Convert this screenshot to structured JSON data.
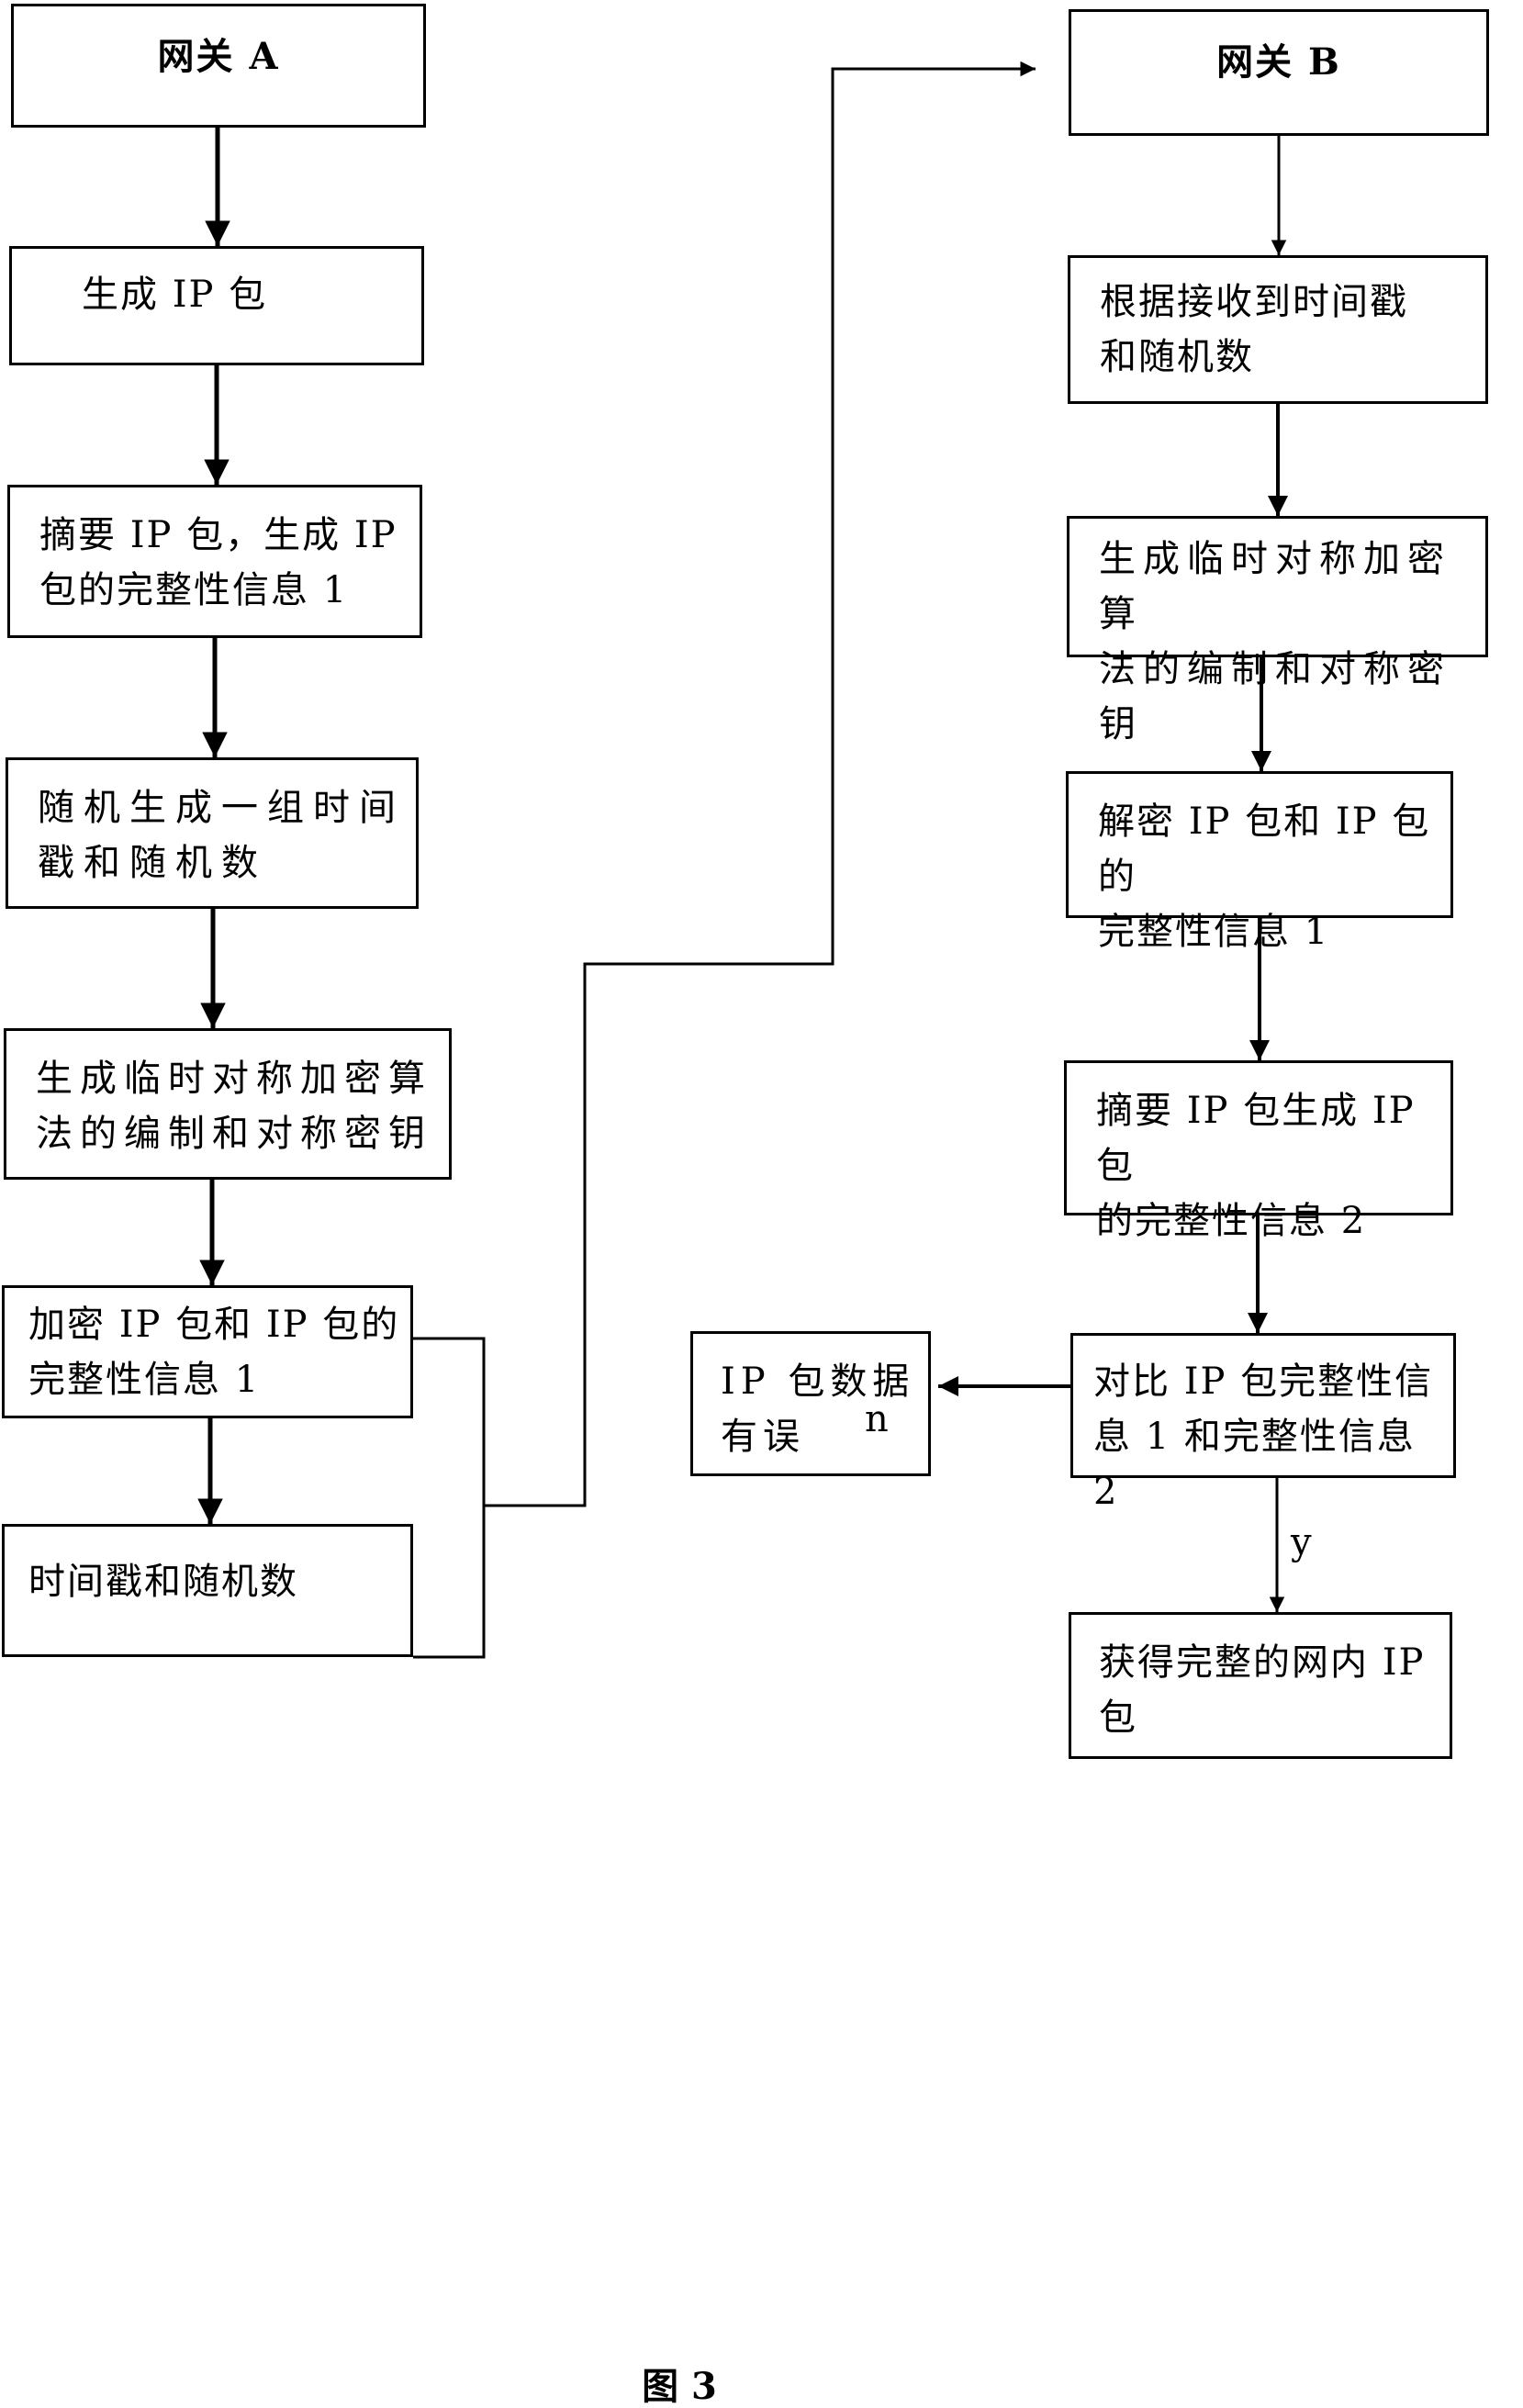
{
  "figure": {
    "caption": "图 3",
    "gateway_a": {
      "title": "网关 A",
      "steps": [
        "生成 IP 包",
        "摘要 IP 包，生成 IP\n包的完整性信息 1",
        "随机生成一组时间\n戳和随机数",
        "生成临时对称加密算\n法的编制和对称密钥",
        "加密 IP 包和 IP 包的\n完整性信息 1",
        "时间戳和随机数"
      ]
    },
    "gateway_b": {
      "title": "网关 B",
      "steps": [
        "根据接收到时间戳\n和随机数",
        "生成临时对称加密算\n法的编制和对称密钥",
        "解密 IP 包和 IP 包的\n完整性信息 1",
        "摘要 IP 包生成 IP 包\n的完整性信息 2",
        "对比 IP 包完整性信\n息 1 和完整性信息 2"
      ],
      "branch_no": {
        "condition": "n",
        "result": "IP 包数据\n有误"
      },
      "branch_yes": {
        "condition": "y",
        "result": "获得完整的网内 IP\n包"
      }
    }
  }
}
